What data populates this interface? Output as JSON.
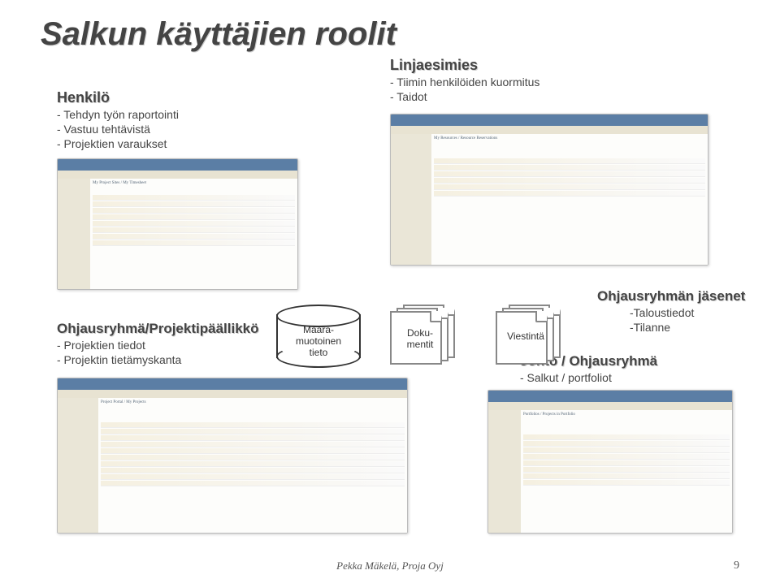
{
  "title": "Salkun käyttäjien roolit",
  "roles": {
    "henkilo": {
      "name": "Henkilö",
      "items": [
        "- Tehdyn työn raportointi",
        "- Vastuu tehtävistä",
        "- Projektien varaukset"
      ]
    },
    "linjaesimies": {
      "name": "Linjaesimies",
      "items": [
        "- Tiimin henkilöiden kuormitus",
        "- Taidot"
      ]
    },
    "ohjausryhma_paallikko": {
      "name": "Ohjausryhmä/Projektipäällikkö",
      "items": [
        "- Projektien tiedot",
        "- Projektin tietämyskanta"
      ]
    },
    "ohjausryhman_jasenet": {
      "name": "Ohjausryhmän jäsenet",
      "items": [
        "-Taloustiedot",
        "-Tilanne"
      ]
    },
    "johto": {
      "name": "Johto / Ohjausryhmä",
      "items": [
        "- Salkut / portfoliot"
      ]
    }
  },
  "diagram": {
    "datastore": "Määrä-\nmuotoinen\ntieto",
    "documents": "Doku-\nmentit",
    "communication": "Viestintä"
  },
  "footer": "Pekka Mäkelä, Proja Oyj",
  "page_number": "9",
  "screenshots": {
    "top_left": "My Project Sites / My Timesheet",
    "top_right": "My Resources / Resource Reservations",
    "bottom_left": "Project Portal / My Projects",
    "bottom_right": "Portfolios / Projects in Portfolio"
  }
}
